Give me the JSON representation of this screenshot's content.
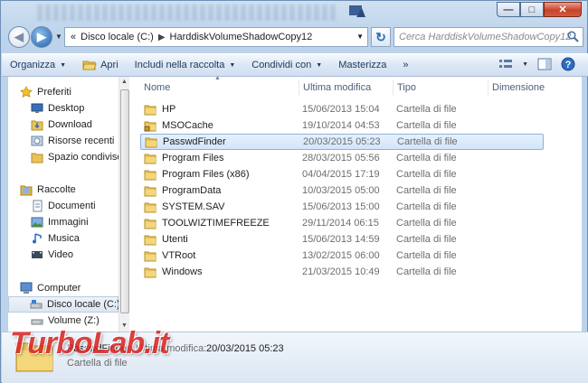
{
  "window": {
    "minimize": "—",
    "maximize": "□",
    "close": "✕"
  },
  "address": {
    "prefix": "«",
    "crumbs": [
      "Disco locale (C:)",
      "HarddiskVolumeShadowCopy12"
    ],
    "search_placeholder": "Cerca HarddiskVolumeShadowCopy12"
  },
  "toolbar": {
    "organize": "Organizza",
    "open": "Apri",
    "include": "Includi nella raccolta",
    "share": "Condividi con",
    "burn": "Masterizza",
    "more": "»"
  },
  "sidebar": {
    "favorites": "Preferiti",
    "fav_items": [
      "Desktop",
      "Download",
      "Risorse recenti",
      "Spazio condiviso"
    ],
    "libraries": "Raccolte",
    "lib_items": [
      "Documenti",
      "Immagini",
      "Musica",
      "Video"
    ],
    "computer": "Computer",
    "drives": [
      "Disco locale (C:)",
      "Volume (Z:)"
    ]
  },
  "columns": {
    "name": "Nome",
    "modified": "Ultima modifica",
    "type": "Tipo",
    "size": "Dimensione"
  },
  "files": [
    {
      "name": "HP",
      "date": "15/06/2013 15:04",
      "type": "Cartella di file"
    },
    {
      "name": "MSOCache",
      "date": "19/10/2014 04:53",
      "type": "Cartella di file"
    },
    {
      "name": "PasswdFinder",
      "date": "20/03/2015 05:23",
      "type": "Cartella di file"
    },
    {
      "name": "Program Files",
      "date": "28/03/2015 05:56",
      "type": "Cartella di file"
    },
    {
      "name": "Program Files (x86)",
      "date": "04/04/2015 17:19",
      "type": "Cartella di file"
    },
    {
      "name": "ProgramData",
      "date": "10/03/2015 05:00",
      "type": "Cartella di file"
    },
    {
      "name": "SYSTEM.SAV",
      "date": "15/06/2013 15:00",
      "type": "Cartella di file"
    },
    {
      "name": "TOOLWIZTIMEFREEZE",
      "date": "29/11/2014 06:15",
      "type": "Cartella di file"
    },
    {
      "name": "Utenti",
      "date": "15/06/2013 14:59",
      "type": "Cartella di file"
    },
    {
      "name": "VTRoot",
      "date": "13/02/2015 06:00",
      "type": "Cartella di file"
    },
    {
      "name": "Windows",
      "date": "21/03/2015 10:49",
      "type": "Cartella di file"
    }
  ],
  "details": {
    "name": "PasswdFinder",
    "modified_label": "Ultima modifica:",
    "modified": "20/03/2015 05:23",
    "type": "Cartella di file"
  },
  "watermark": "TurboLab.it",
  "colors": {
    "folder": "#e8c25a",
    "selection": "#d2e5fa",
    "toolbar_text": "#1e395b"
  }
}
